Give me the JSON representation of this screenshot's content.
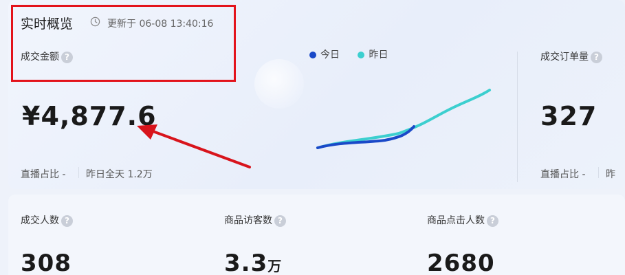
{
  "overview": {
    "title": "实时概览",
    "updated": "更新于 06-08 13:40:16"
  },
  "metrics": {
    "gmv": {
      "label": "成交金额",
      "value": "¥4,877.6",
      "live_ratio": "直播占比 -",
      "yesterday": "昨日全天 1.2万"
    },
    "orders": {
      "label": "成交订单量",
      "value": "327",
      "live_ratio": "直播占比 -",
      "yesterday": "昨"
    }
  },
  "legend": {
    "today": "今日",
    "yesterday": "昨日"
  },
  "bottom": {
    "buyers": {
      "label": "成交人数",
      "value": "308"
    },
    "visitors": {
      "label": "商品访客数",
      "value": "3.3",
      "unit": "万"
    },
    "clicks": {
      "label": "商品点击人数",
      "value": "2680"
    }
  },
  "help_glyph": "?",
  "colors": {
    "today": "#1a49c8",
    "yesterday": "#3ccfcf",
    "highlight": "#e3131b",
    "arrow": "#d8141c"
  }
}
